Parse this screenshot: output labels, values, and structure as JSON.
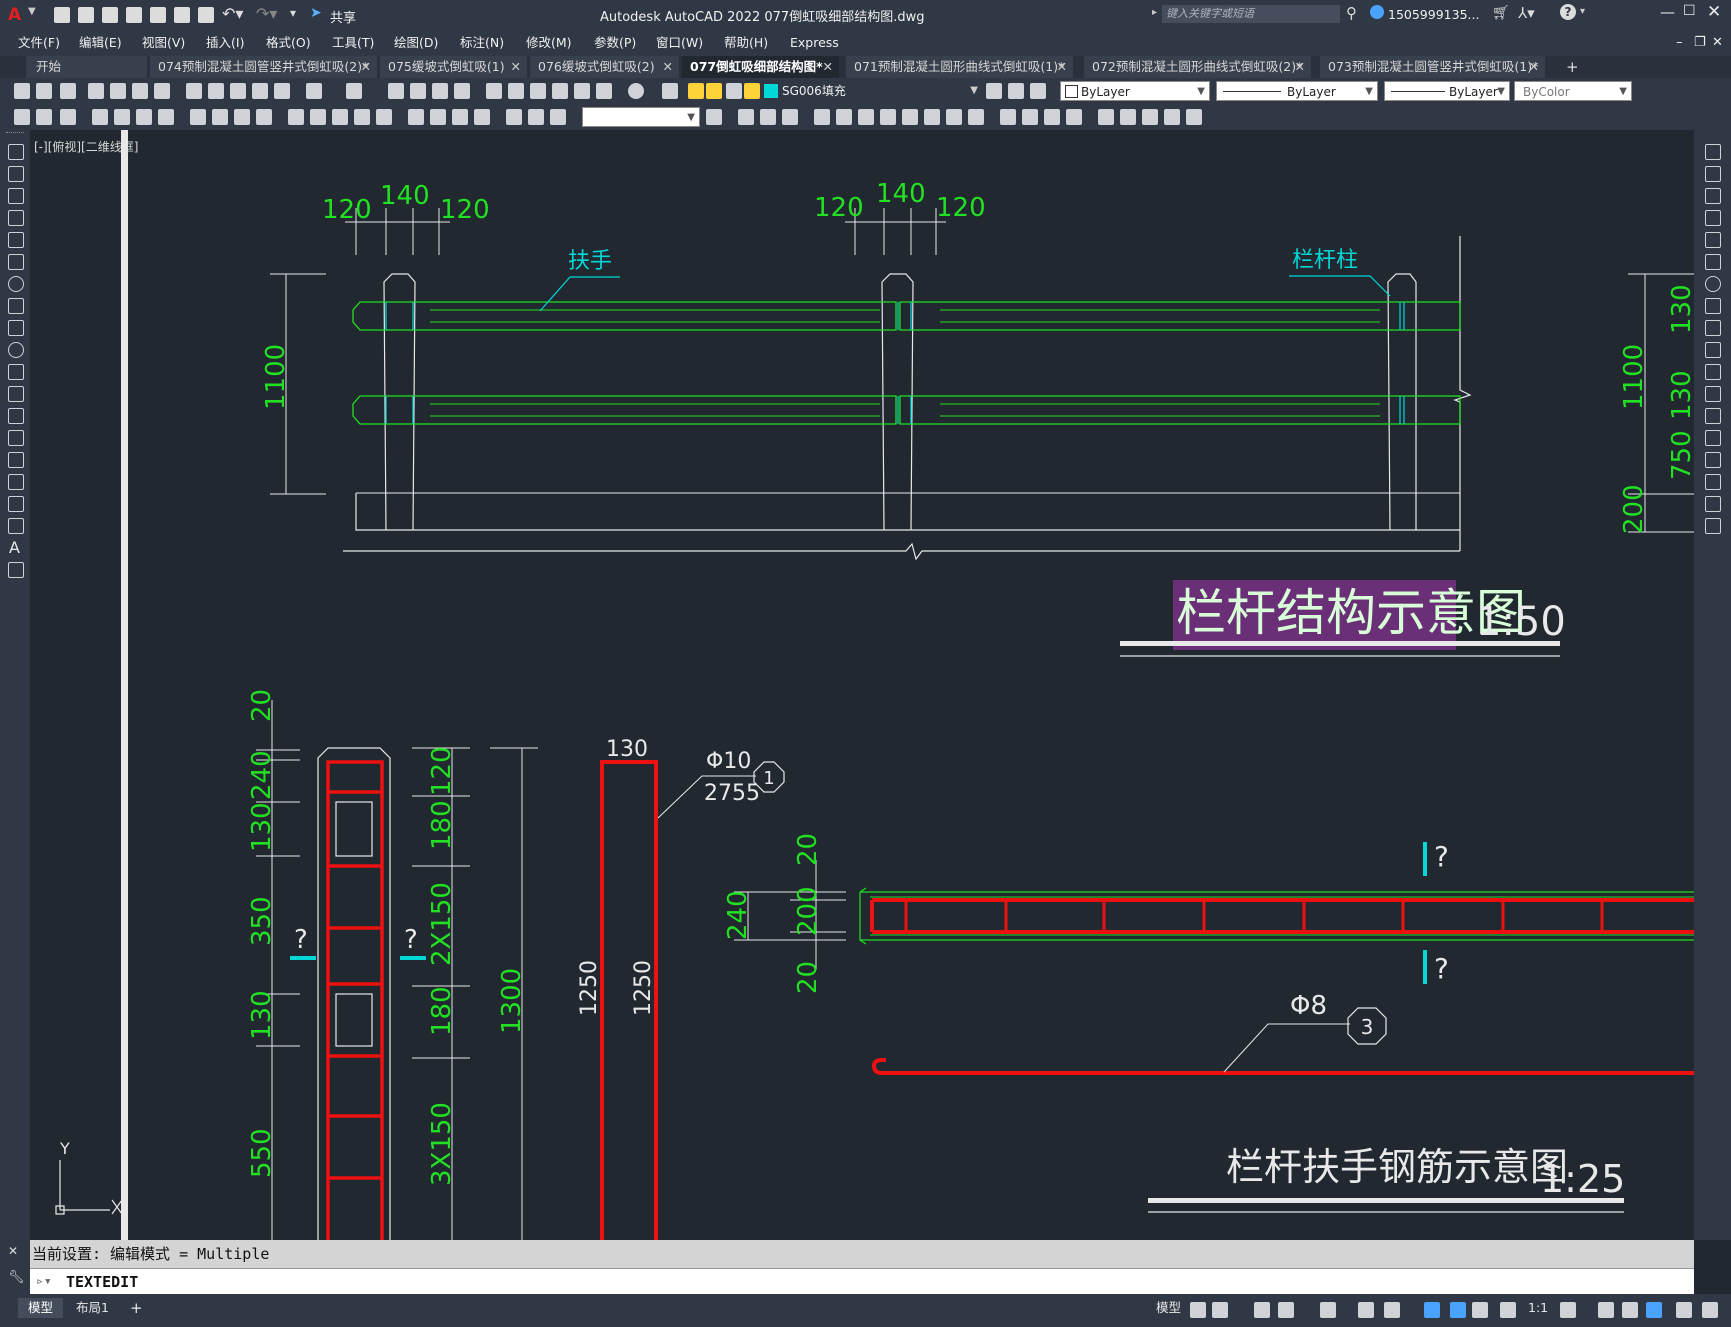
{
  "app": {
    "title": "Autodesk AutoCAD 2022    077倒虹吸细部结构图.dwg",
    "share_label": "共享",
    "search_placeholder": "键入关键字或短语",
    "user": "1505999135..."
  },
  "menu": [
    "文件(F)",
    "编辑(E)",
    "视图(V)",
    "插入(I)",
    "格式(O)",
    "工具(T)",
    "绘图(D)",
    "标注(N)",
    "修改(M)",
    "参数(P)",
    "窗口(W)",
    "帮助(H)",
    "Express"
  ],
  "tabs": [
    {
      "label": "开始",
      "closable": false,
      "active": false
    },
    {
      "label": "074预制混凝土圆管竖井式倒虹吸(2)*",
      "closable": true,
      "active": false
    },
    {
      "label": "075缓坡式倒虹吸(1)",
      "closable": true,
      "active": false
    },
    {
      "label": "076缓坡式倒虹吸(2)",
      "closable": true,
      "active": false
    },
    {
      "label": "077倒虹吸细部结构图*",
      "closable": true,
      "active": true
    },
    {
      "label": "071预制混凝土圆形曲线式倒虹吸(1)*",
      "closable": true,
      "active": false
    },
    {
      "label": "072预制混凝土圆形曲线式倒虹吸(2)*",
      "closable": true,
      "active": false
    },
    {
      "label": "073预制混凝土圆管竖井式倒虹吸(1)*",
      "closable": true,
      "active": false
    }
  ],
  "properties": {
    "layer": "SG006填充",
    "color": "ByLayer",
    "linetype": "ByLayer",
    "lineweight": "ByLayer",
    "plotstyle": "ByColor",
    "layer_color": "#00d8d8"
  },
  "viewport_label": "[-][俯视][二维线框]",
  "drawing": {
    "title1": "栏杆结构示意图",
    "scale1": "1:50",
    "title2": "栏杆扶手钢筋示意图",
    "scale2": "1:25",
    "label_handrail": "扶手",
    "label_post": "栏杆柱",
    "dims_top_left": [
      "120",
      "140",
      "120"
    ],
    "dims_top_mid": [
      "120",
      "140",
      "120"
    ],
    "dim_height_left": "1100",
    "dim_height_right": "1100",
    "dim_right_130a": "130",
    "dim_right_130b": "130",
    "dim_right_750": "750",
    "dim_right_200": "200",
    "post_dims_left": [
      "20",
      "240",
      "130",
      "350",
      "130",
      "550"
    ],
    "post_dims_right": [
      "120",
      "180",
      "2X150",
      "180",
      "3X150"
    ],
    "post_dim_total": "1300",
    "bar_width": "130",
    "bar_len_a": "1250",
    "bar_len_b": "1250",
    "rebar1_dia": "Φ10",
    "rebar1_len": "2755",
    "rebar1_no": "1",
    "rebar3_dia": "Φ8",
    "rebar3_no": "3",
    "sec_dims": [
      "20",
      "240",
      "200",
      "20"
    ],
    "q_mark": "?",
    "axis_y": "Y",
    "colors": {
      "green": "#22e022",
      "cyan": "#00d8d8",
      "red": "#ee1111",
      "white": "#e8e8e8",
      "title_bg": "#6a2f77"
    }
  },
  "command": {
    "history": "当前设置: 编辑模式 = Multiple",
    "prompt": "TEXTEDIT"
  },
  "status": {
    "tabs": [
      "模型",
      "布局1"
    ],
    "model_label": "模型",
    "scale": "1:1"
  }
}
